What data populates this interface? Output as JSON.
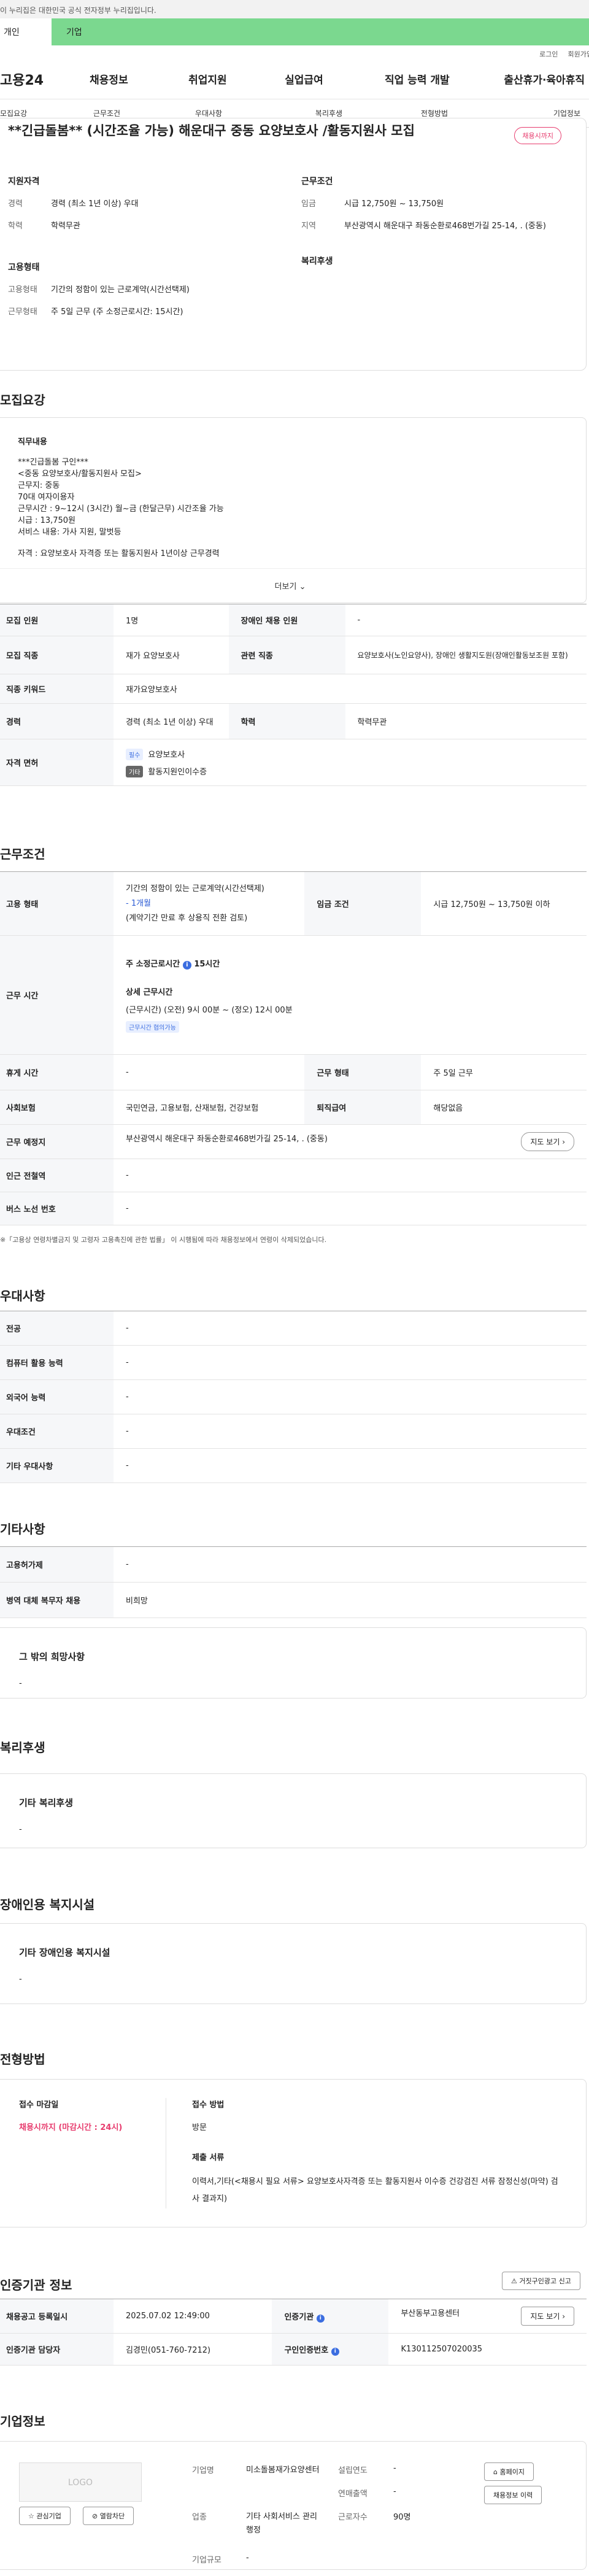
{
  "gov_banner": "이 누리집은 대한민국 공식 전자정부 누리집입니다.",
  "user_tabs": {
    "personal": "개인",
    "company": "기업"
  },
  "util": {
    "login": "로그인",
    "join": "회원가입"
  },
  "gnb": {
    "logo": "고용24",
    "menu": [
      "채용정보",
      "취업지원",
      "실업급여",
      "직업 능력 개발",
      "출산휴가·육아휴직"
    ]
  },
  "snb": [
    "모집요강",
    "근무조건",
    "우대사항",
    "복리후생",
    "전형방법",
    "기업정보"
  ],
  "job": {
    "title": "**긴급돌봄** (시간조율 가능) 해운대구 중동 요양보호사 /활동지원사 모집",
    "badge": "채용시까지",
    "qual_title": "지원자격",
    "cond_title": "근무조건",
    "type_title": "고용형태",
    "welfare_title": "복리후생",
    "career_k": "경력",
    "career_v": "경력 (최소 1년 이상) 우대",
    "edu_k": "학력",
    "edu_v": "학력무관",
    "wage_k": "임금",
    "wage_v": "시급 12,750원 ~ 13,750원",
    "area_k": "지역",
    "area_v": "부산광역시 해운대구 좌동순환로468번가길 25-14, . (중동)",
    "etype_k": "고용형태",
    "etype_v": "기간의 정함이 있는 근로계약(시간선택제)",
    "form_k": "근무형태",
    "form_v": "주 5일 근무 (주 소정근로시간: 15시간)"
  },
  "recruit": {
    "section": "모집요강",
    "desc_title": "직무내용",
    "desc_lines": [
      "***긴급돌봄 구인***",
      "<중동 요양보호사/활동지원사 모집>",
      "근무지: 중동",
      "70대 여자이용자",
      "근무시간 : 9~12시 (3시간) 월~금 (한달근무) 시간조율 가능",
      "시급 : 13,750원",
      "서비스 내용:  가사 지원,  말벗등",
      "",
      "자격 : 요양보호사 자격증 또는 활동지원사 1년이상 근무경력"
    ],
    "more": "더보기",
    "rows": {
      "count_k": "모집 인원",
      "count_v": "1명",
      "disabled_k": "장애인 채용 인원",
      "disabled_v": "-",
      "job_k": "모집 직종",
      "job_v": "재가 요양보호사",
      "rel_k": "관련 직종",
      "rel_v": "요양보호사(노인요양사), 장애인 생활지도원(장애인활동보조원 포함)",
      "kw_k": "직종 키워드",
      "kw_v": "재가요양보호사",
      "career_k": "경력",
      "career_v": "경력 (최소 1년 이상) 우대",
      "edu_k": "학력",
      "edu_v": "학력무관",
      "lic_k": "자격 면허",
      "lic1_tag": "필수",
      "lic1": "요양보호사",
      "lic2_tag": "기타",
      "lic2": "활동지원인이수증"
    }
  },
  "conditions": {
    "section": "근무조건",
    "etype_k": "고용 형태",
    "etype_v1": "기간의 정함이 있는 근로계약(시간선택제)",
    "etype_v2": "- 1개월",
    "etype_v3": "(계약기간 만료 후 상용직 전환 검토)",
    "wage_k": "임금 조건",
    "wage_v": "시급 12,750원 ~ 13,750원 이하",
    "time_k": "근무 시간",
    "time_weekly": "주 소정근로시간",
    "time_weekly_v": "15시간",
    "time_detail_t": "상세 근무시간",
    "time_detail_v": "(근무시간) (오전) 9시 00분 ~ (정오) 12시 00분",
    "time_badge": "근무시간 협의가능",
    "rest_k": "휴게 시간",
    "rest_v": "-",
    "form_k": "근무 형태",
    "form_v": "주 5일 근무",
    "ins_k": "사회보험",
    "ins_v": "국민연금, 고용보험, 산재보험, 건강보험",
    "pension_k": "퇴직급여",
    "pension_v": "해당없음",
    "place_k": "근무 예정지",
    "place_v": "부산광역시 해운대구 좌동순환로468번가길 25-14, . (중동)",
    "map_btn": "지도 보기",
    "subway_k": "인근 전철역",
    "subway_v": "-",
    "bus_k": "버스 노선 번호",
    "bus_v": "-",
    "note": "※「고용상 연령차별금지 및 고령자 고용촉진에 관한 법률」 이 시행됨에 따라 채용정보에서 연령이 삭제되었습니다."
  },
  "prefs": {
    "section": "우대사항",
    "rows": [
      {
        "k": "전공",
        "v": "-"
      },
      {
        "k": "컴퓨터 활용 능력",
        "v": "-"
      },
      {
        "k": "외국어 능력",
        "v": "-"
      },
      {
        "k": "우대조건",
        "v": "-"
      },
      {
        "k": "기타 우대사항",
        "v": "-"
      }
    ]
  },
  "etc": {
    "section": "기타사항",
    "rows": [
      {
        "k": "고용허가제",
        "v": "-"
      },
      {
        "k": "병역 대체 복무자 채용",
        "v": "비희망"
      }
    ],
    "hope_t": "그 밖의 희망사항",
    "hope_v": "-"
  },
  "welfare": {
    "section": "복리후생",
    "t": "기타 복리후생",
    "v": "-"
  },
  "facility": {
    "section": "장애인용 복지시설",
    "t": "기타 장애인용 복지시설",
    "v": "-"
  },
  "process": {
    "section": "전형방법",
    "deadline_t": "접수 마감일",
    "deadline_v": "채용시까지 (마감시간 : 24시)",
    "method_t": "접수 방법",
    "method_v": "방문",
    "docs_t": "제출 서류",
    "docs_v": "이력서,기타(<채용시 필요 서류> 요양보호사자격증 또는  활동지원사 이수증 건강검진 서류  잠정신성(마약) 검사 결과지)"
  },
  "agency": {
    "section": "인증기관 정보",
    "report_btn": "거짓구인광고 신고",
    "reg_k": "채용공고 등록일시",
    "reg_v": "2025.07.02 12:49:00",
    "org_k": "인증기관",
    "org_v": "부산동부고용센터",
    "map_btn": "지도 보기",
    "staff_k": "인증기관 담당자",
    "staff_v": "김경민(051-760-7212)",
    "num_k": "구인인증번호",
    "num_v": "K130112507020035"
  },
  "company": {
    "section": "기업정보",
    "logo": "LOGO",
    "fav": "관심기업",
    "block": "열람차단",
    "name_k": "기업명",
    "name_v": "미소돌봄재가요양센터",
    "est_k": "설립연도",
    "est_v": "-",
    "home_btn": "홈페이지",
    "ind_k": "업종",
    "ind_v": "기타 사회서비스 관리 행정",
    "sales_k": "연매출액",
    "sales_v": "-",
    "jobs_btn": "채용정보 이력",
    "emp_k": "근로자수",
    "emp_v": "90명",
    "size_k": "기업규모",
    "size_v": "-"
  }
}
